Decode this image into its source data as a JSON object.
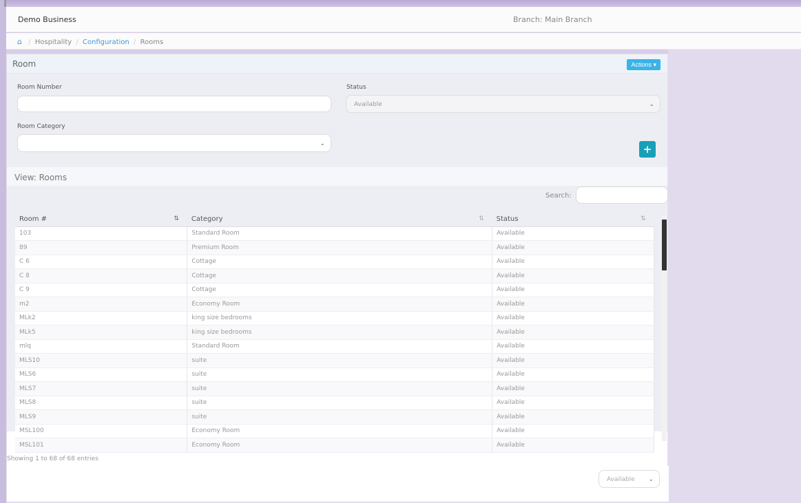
{
  "header": {
    "business_name": "Demo Business",
    "branch": "Branch: Main Branch"
  },
  "breadcrumb": {
    "home_icon": "home-icon",
    "items": [
      "Hospitality",
      "Configuration",
      "Rooms"
    ]
  },
  "room_form": {
    "title": "Room",
    "actions_label": "Actions ▾",
    "room_number_label": "Room Number",
    "room_number_value": "",
    "status_label": "Status",
    "status_value": "Available",
    "room_category_label": "Room Category",
    "room_category_value": "",
    "add_icon": "plus-icon"
  },
  "view": {
    "title": "View: Rooms",
    "search_label": "Search:",
    "search_value": "",
    "columns": [
      "Room #",
      "Category",
      "Status"
    ],
    "rows": [
      [
        "103",
        "Standard Room",
        "Available"
      ],
      [
        "89",
        "Premium Room",
        "Available"
      ],
      [
        "C 6",
        "Cottage",
        "Available"
      ],
      [
        "C 8",
        "Cottage",
        "Available"
      ],
      [
        "C 9",
        "Cottage",
        "Available"
      ],
      [
        "m2",
        "Economy Room",
        "Available"
      ],
      [
        "MLk2",
        "king size bedrooms",
        "Available"
      ],
      [
        "MLk5",
        "king size bedrooms",
        "Available"
      ],
      [
        "mlq",
        "Standard Room",
        "Available"
      ],
      [
        "MLS10",
        "suite",
        "Available"
      ],
      [
        "MLS6",
        "suite",
        "Available"
      ],
      [
        "MLS7",
        "suite",
        "Available"
      ],
      [
        "MLS8",
        "suite",
        "Available"
      ],
      [
        "MLS9",
        "suite",
        "Available"
      ],
      [
        "MSL100",
        "Economy Room",
        "Available"
      ],
      [
        "MSL101",
        "Economy Room",
        "Available"
      ]
    ],
    "entries_text": "Showing 1 to 68 of 68 entries",
    "filter_value": "Available"
  },
  "colors": {
    "accent": "#3ab3e6",
    "add_button": "#18a0b8"
  }
}
